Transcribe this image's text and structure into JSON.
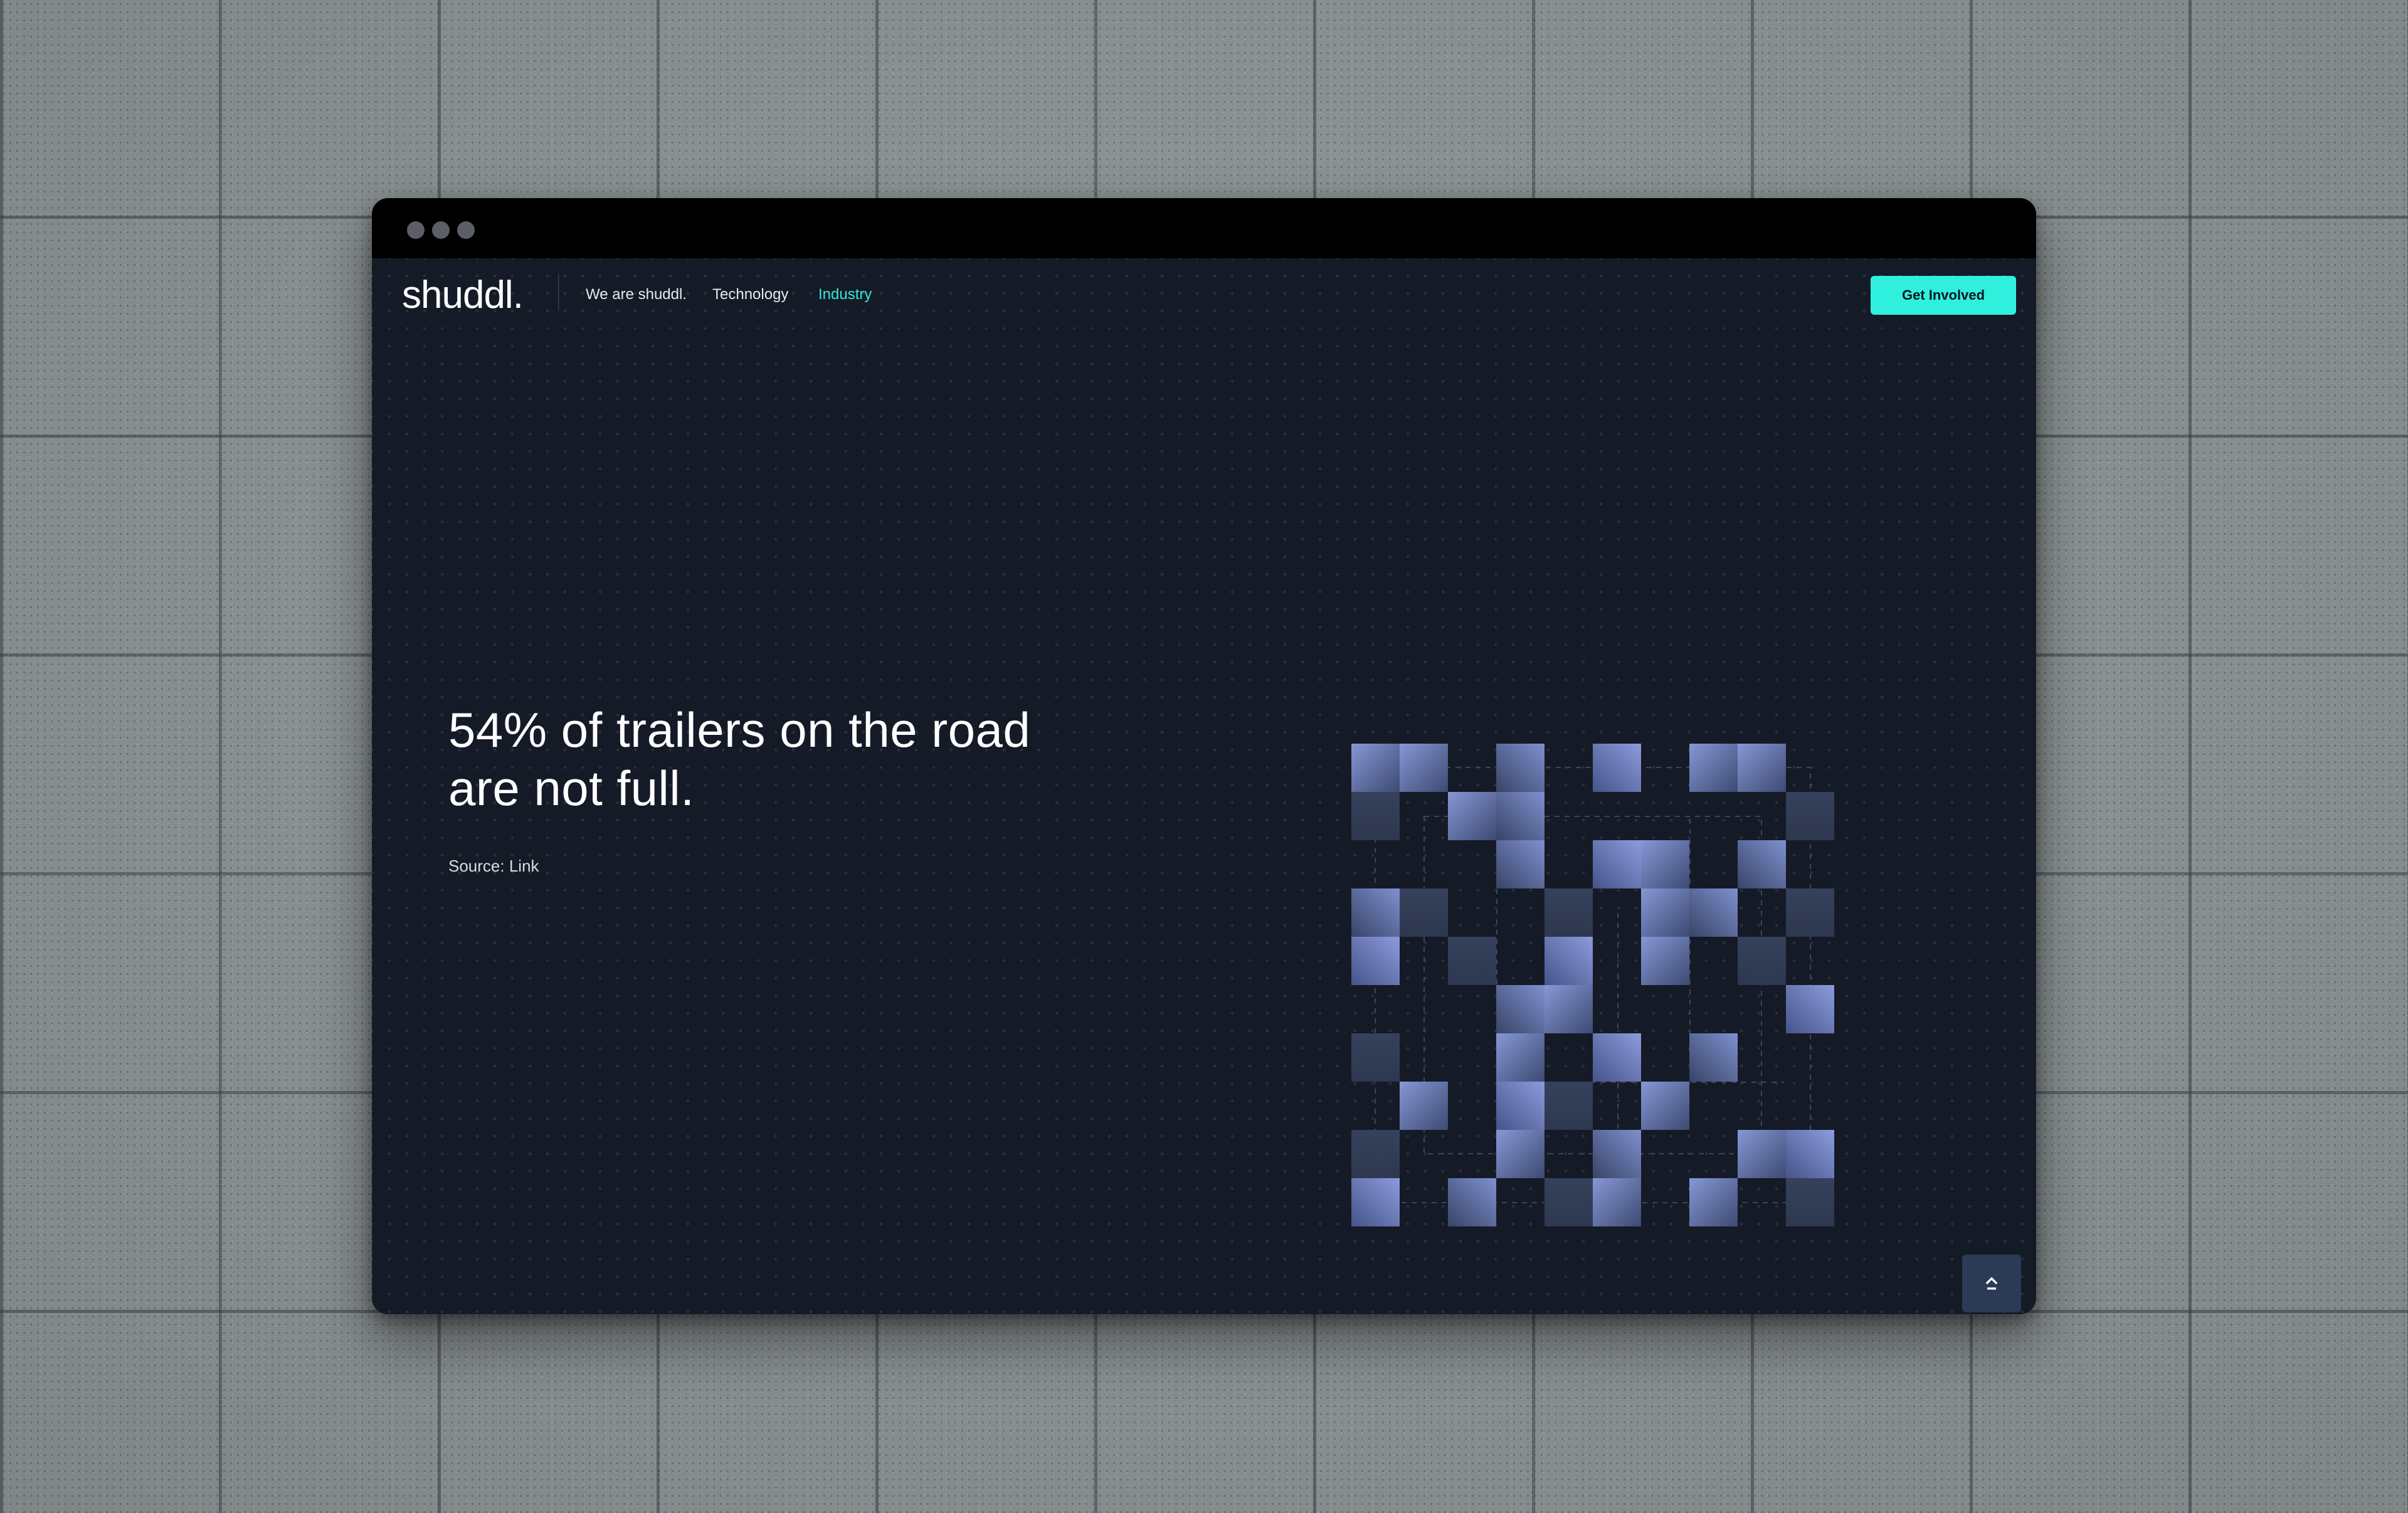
{
  "brand": {
    "logo_text": "shuddl."
  },
  "nav": {
    "links": [
      {
        "label": "We are shuddl."
      },
      {
        "label": "Technology"
      },
      {
        "label": "Industry",
        "active": true
      }
    ],
    "cta_label": "Get Involved"
  },
  "hero": {
    "headline": "54% of trailers on the road are not full.",
    "source_prefix": "Source: ",
    "source_link": "Link"
  },
  "graphic": {
    "icon": "pixel-grid-graphic"
  },
  "scroll_top": {
    "icon": "chevron-up-icon"
  },
  "colors": {
    "page_background": "#151a27",
    "accent": "#2ff0dd",
    "active_link": "#34e8d6",
    "pixel_light": "#7d8fcf",
    "pixel_dark": "#2f3950",
    "scroll_button": "#2b3a55"
  }
}
